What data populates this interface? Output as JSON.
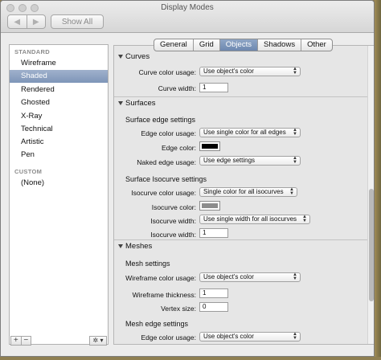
{
  "window": {
    "title": "Display Modes"
  },
  "toolbar": {
    "back": "◀",
    "forward": "▶",
    "show_all": "Show All"
  },
  "sidebar": {
    "standard_header": "STANDARD",
    "standard_items": [
      "Wireframe",
      "Shaded",
      "Rendered",
      "Ghosted",
      "X-Ray",
      "Technical",
      "Artistic",
      "Pen"
    ],
    "selected": "Shaded",
    "custom_header": "CUSTOM",
    "custom_items": [
      "(None)"
    ],
    "add": "+",
    "remove": "−",
    "gear": "✲ ▾"
  },
  "tabs": [
    "General",
    "Grid",
    "Objects",
    "Shadows",
    "Other"
  ],
  "active_tab": "Objects",
  "curves": {
    "header": "Curves",
    "color_usage_label": "Curve color usage:",
    "color_usage_value": "Use object's color",
    "width_label": "Curve width:",
    "width_value": "1"
  },
  "surfaces": {
    "header": "Surfaces",
    "edge_settings_title": "Surface edge settings",
    "edge_color_usage_label": "Edge color usage:",
    "edge_color_usage_value": "Use single color for all edges",
    "edge_color_label": "Edge color:",
    "edge_color": "#000000",
    "naked_edge_usage_label": "Naked edge usage:",
    "naked_edge_usage_value": "Use edge settings",
    "isocurve_title": "Surface Isocurve settings",
    "iso_color_usage_label": "Isocurve color usage:",
    "iso_color_usage_value": "Single color for all isocurves",
    "iso_color_label": "Isocurve color:",
    "iso_color": "#8c8c8c",
    "iso_width_usage_label": "Isocurve width:",
    "iso_width_usage_value": "Use single width for all isocurves",
    "iso_width_label": "Isocurve width:",
    "iso_width_value": "1"
  },
  "meshes": {
    "header": "Meshes",
    "settings_title": "Mesh settings",
    "wire_color_label": "Wireframe color usage:",
    "wire_color_value": "Use object's color",
    "wire_thickness_label": "Wireframe thickness:",
    "wire_thickness_value": "1",
    "vertex_size_label": "Vertex size:",
    "vertex_size_value": "0",
    "edge_settings_title": "Mesh edge settings",
    "edge_color_usage_label": "Edge color usage:",
    "edge_color_usage_value": "Use object's color"
  }
}
